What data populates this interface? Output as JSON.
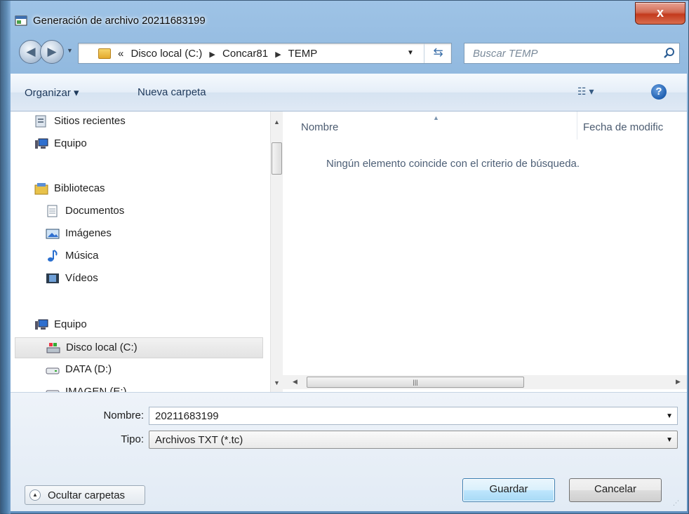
{
  "window": {
    "title": "Generación de archivo 20211683199",
    "close_label": "x"
  },
  "nav": {
    "back_label": "◀",
    "forward_label": "▶",
    "breadcrumb": [
      "«",
      "Disco local (C:)",
      "Concar81",
      "TEMP"
    ],
    "search_placeholder": "Buscar TEMP"
  },
  "toolbar": {
    "organize_label": "Organizar ▾",
    "new_folder_label": "Nueva carpeta"
  },
  "sidebar": {
    "items": [
      {
        "label": "Sitios recientes",
        "icon": "recent-places-icon"
      },
      {
        "label": "Equipo",
        "icon": "computer-icon"
      },
      {
        "label": "Bibliotecas",
        "icon": "libraries-icon"
      },
      {
        "label": "Documentos",
        "icon": "documents-icon"
      },
      {
        "label": "Imágenes",
        "icon": "pictures-icon"
      },
      {
        "label": "Música",
        "icon": "music-icon"
      },
      {
        "label": "Vídeos",
        "icon": "videos-icon"
      },
      {
        "label": "Equipo",
        "icon": "computer-icon"
      },
      {
        "label": "Disco local (C:)",
        "icon": "local-disk-icon",
        "selected": true
      },
      {
        "label": "DATA (D:)",
        "icon": "drive-icon"
      },
      {
        "label": "IMAGEN (E:)",
        "icon": "drive-icon"
      }
    ]
  },
  "content": {
    "columns": [
      "Nombre",
      "Fecha de modific"
    ],
    "empty_message": "Ningún elemento coincide con el criterio de búsqueda."
  },
  "form": {
    "name_label": "Nombre:",
    "name_value": "20211683199",
    "type_label": "Tipo:",
    "type_value": "Archivos TXT (*.tc)"
  },
  "buttons": {
    "hide_folders": "Ocultar carpetas",
    "save": "Guardar",
    "cancel": "Cancelar"
  },
  "colors": {
    "frame": "#7ba7d2",
    "close": "#c3391c",
    "link_text": "#1e395b",
    "primary_button": "#bee6fd"
  }
}
